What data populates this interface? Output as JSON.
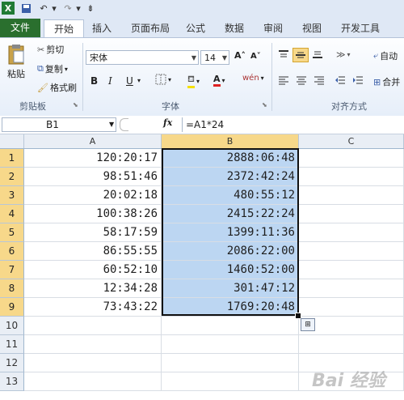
{
  "quick_access": {
    "save_icon": "save-icon",
    "undo_icon": "undo-icon",
    "redo_icon": "redo-icon"
  },
  "tabs": [
    "文件",
    "开始",
    "插入",
    "页面布局",
    "公式",
    "数据",
    "审阅",
    "视图",
    "开发工具"
  ],
  "ribbon": {
    "clipboard": {
      "paste": "粘贴",
      "cut": "剪切",
      "copy": "复制",
      "copy_dd": "▾",
      "format_painter": "格式刷",
      "group": "剪贴板"
    },
    "font": {
      "name": "宋体",
      "size": "14",
      "bold": "B",
      "italic": "I",
      "underline": "U",
      "grow": "A˄",
      "shrink": "A˅",
      "phonetic": "wén",
      "group": "字体"
    },
    "alignment": {
      "wrap": "自动",
      "merge": "合并",
      "group": "对齐方式"
    }
  },
  "formula_bar": {
    "name_box": "B1",
    "fx": "fx",
    "formula": "=A1*24"
  },
  "columns": [
    "A",
    "B",
    "C"
  ],
  "rows": [
    {
      "n": "1",
      "a": "120:20:17",
      "b": "2888:06:48"
    },
    {
      "n": "2",
      "a": "98:51:46",
      "b": "2372:42:24"
    },
    {
      "n": "3",
      "a": "20:02:18",
      "b": "480:55:12"
    },
    {
      "n": "4",
      "a": "100:38:26",
      "b": "2415:22:24"
    },
    {
      "n": "5",
      "a": "58:17:59",
      "b": "1399:11:36"
    },
    {
      "n": "6",
      "a": "86:55:55",
      "b": "2086:22:00"
    },
    {
      "n": "7",
      "a": "60:52:10",
      "b": "1460:52:00"
    },
    {
      "n": "8",
      "a": "12:34:28",
      "b": "301:47:12"
    },
    {
      "n": "9",
      "a": "73:43:22",
      "b": "1769:20:48"
    },
    {
      "n": "10",
      "a": "",
      "b": ""
    },
    {
      "n": "11",
      "a": "",
      "b": ""
    },
    {
      "n": "12",
      "a": "",
      "b": ""
    },
    {
      "n": "13",
      "a": "",
      "b": ""
    }
  ],
  "selected_rows": [
    "1",
    "2",
    "3",
    "4",
    "5",
    "6",
    "7",
    "8",
    "9"
  ],
  "watermark": "Bai 经验"
}
